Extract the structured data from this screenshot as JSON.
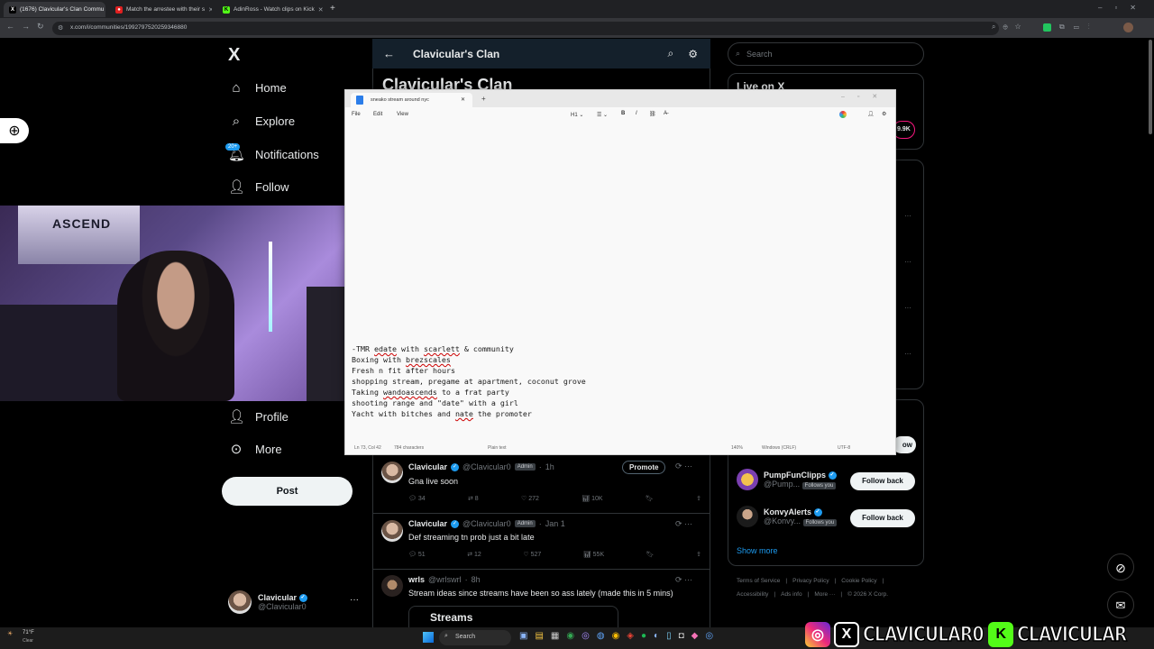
{
  "browser": {
    "tabs": [
      {
        "label": "(1676) Clavicular's Clan Commu",
        "favicon": "X"
      },
      {
        "label": "Match the arrestee with their s",
        "favicon": "red"
      },
      {
        "label": "AdinRoss - Watch clips on Kick",
        "favicon": "K"
      }
    ],
    "new_tab": "+",
    "url": "x.com/i/communities/1992797520259346880"
  },
  "nav": {
    "logo": "X",
    "items": [
      {
        "label": "Home",
        "icon": "home-icon"
      },
      {
        "label": "Explore",
        "icon": "search-icon"
      },
      {
        "label": "Notifications",
        "icon": "bell-icon",
        "badge": "20+"
      },
      {
        "label": "Follow",
        "icon": "person-plus-icon"
      },
      {
        "label": "Profile",
        "icon": "person-icon"
      },
      {
        "label": "More",
        "icon": "more-circle-icon"
      }
    ],
    "post_button": "Post",
    "account": {
      "name": "Clavicular",
      "handle": "@Clavicular0"
    }
  },
  "community": {
    "header_title": "Clavicular's Clan",
    "big_title": "Clavicular's Clan"
  },
  "right": {
    "search_placeholder": "Search",
    "live_title": "Live on X",
    "live_count": "9.9K",
    "follow_partial": "ow",
    "suggestions": [
      {
        "name": "PumpFunClipps",
        "handle": "@Pump...",
        "tag": "Follows you",
        "button": "Follow back"
      },
      {
        "name": "KonvyAlerts",
        "handle": "@Konvy...",
        "tag": "Follows you",
        "button": "Follow back"
      }
    ],
    "show_more": "Show more",
    "footer": {
      "line1": [
        "Terms of Service",
        "Privacy Policy",
        "Cookie Policy"
      ],
      "line2": [
        "Accessibility",
        "Ads info",
        "More ···",
        "© 2026 X Corp."
      ]
    }
  },
  "notepad": {
    "tab_title": "sneako stream around nyc",
    "menu": [
      "File",
      "Edit",
      "View"
    ],
    "heading_ctrl": "H1",
    "lines": [
      "-TMR edate with scarlett & community",
      "Boxing with brezscales",
      "Fresh n fit after hours",
      "shopping stream, pregame at apartment, coconut grove",
      "Taking wandoascends to a frat party",
      "shooting range and \"date\" with a girl",
      "Yacht with bitches and nate the promoter"
    ],
    "status": {
      "position": "Ln 73, Col 42",
      "chars": "784 characters",
      "format": "Plain text",
      "zoom": "140%",
      "eol": "Windows (CRLF)",
      "encoding": "UTF-8"
    }
  },
  "tweets": [
    {
      "name": "Clavicular",
      "handle": "@Clavicular0",
      "role": "Admin",
      "time": "1h",
      "promote": "Promote",
      "text": "Gna live soon",
      "replies": "34",
      "reposts": "8",
      "likes": "272",
      "views": "10K"
    },
    {
      "name": "Clavicular",
      "handle": "@Clavicular0",
      "role": "Admin",
      "time": "Jan 1",
      "text": "Def streaming tn prob just a bit late",
      "replies": "51",
      "reposts": "12",
      "likes": "527",
      "views": "55K"
    },
    {
      "name": "wrls",
      "handle": "@wrlswrl",
      "time": "8h",
      "text": "Stream ideas since streams have been so ass lately (made this in 5 mins)",
      "card_title": "Streams"
    }
  ],
  "taskbar": {
    "weather_temp": "71°F",
    "weather_desc": "Clear",
    "search": "Search"
  },
  "overlay": {
    "social_text_1": "CLAVICULAR0",
    "social_text_2": "CLAVICULAR"
  },
  "colors": {
    "accent": "#1d9bf0",
    "header_bg": "#14202b",
    "background": "#000000"
  }
}
